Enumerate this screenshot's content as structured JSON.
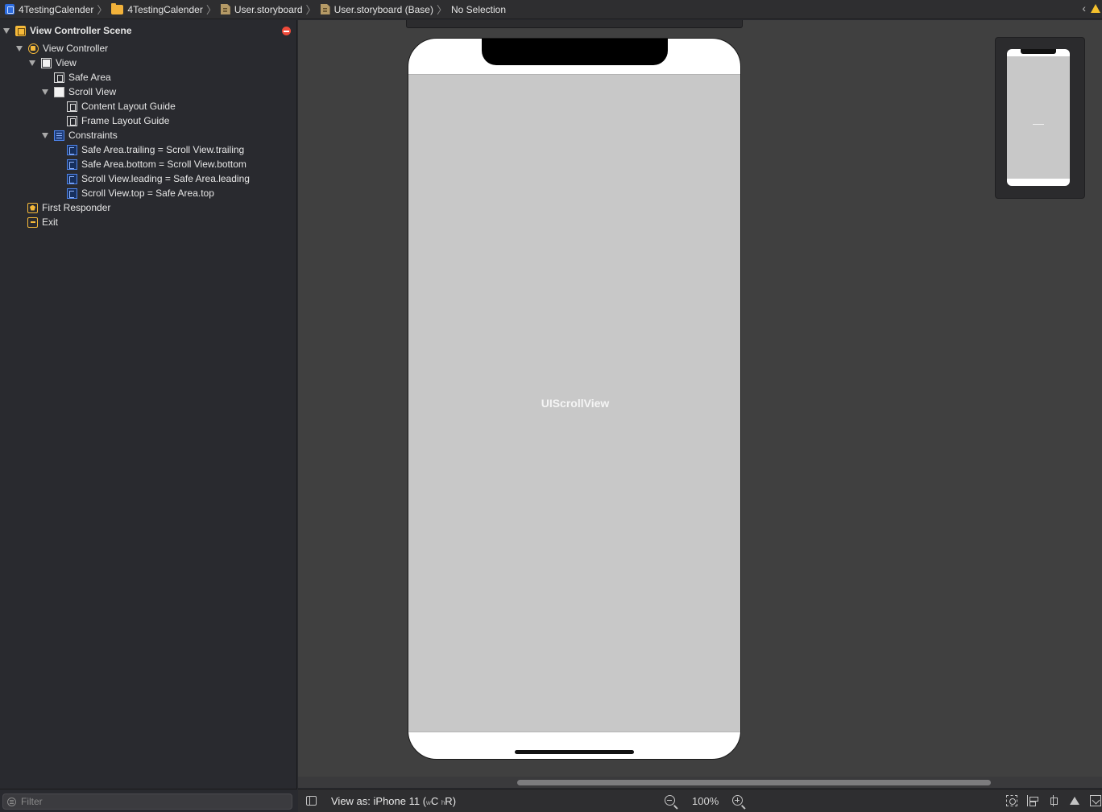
{
  "breadcrumbs": [
    {
      "label": "4TestingCalender",
      "icon": "xcodeproj-icon"
    },
    {
      "label": "4TestingCalender",
      "icon": "folder-icon"
    },
    {
      "label": "User.storyboard",
      "icon": "storyboard-file-icon"
    },
    {
      "label": "User.storyboard (Base)",
      "icon": "storyboard-file-icon"
    },
    {
      "label": "No Selection"
    }
  ],
  "outline": {
    "scene": "View Controller Scene",
    "view_controller": "View Controller",
    "view": "View",
    "safe_area": "Safe Area",
    "scroll_view": "Scroll View",
    "content_layout_guide": "Content Layout Guide",
    "frame_layout_guide": "Frame Layout Guide",
    "constraints": "Constraints",
    "constraint_items": [
      "Safe Area.trailing = Scroll View.trailing",
      "Safe Area.bottom = Scroll View.bottom",
      "Scroll View.leading = Safe Area.leading",
      "Scroll View.top = Safe Area.top"
    ],
    "first_responder": "First Responder",
    "exit": "Exit"
  },
  "filter": {
    "placeholder": "Filter",
    "value": ""
  },
  "canvas": {
    "scroll_view_label": "UIScrollView"
  },
  "toolbar": {
    "view_as_prefix": "View as: iPhone 11 (",
    "size_w": "w",
    "size_c": "C",
    "size_h": "h",
    "size_r": "R",
    "view_as_suffix": ")",
    "zoom_level": "100%"
  },
  "colors": {
    "accent_orange": "#f5b93a",
    "constraint_blue": "#4e86f0",
    "error_red": "#ef4a3a",
    "warning_yellow": "#f5c12d"
  }
}
